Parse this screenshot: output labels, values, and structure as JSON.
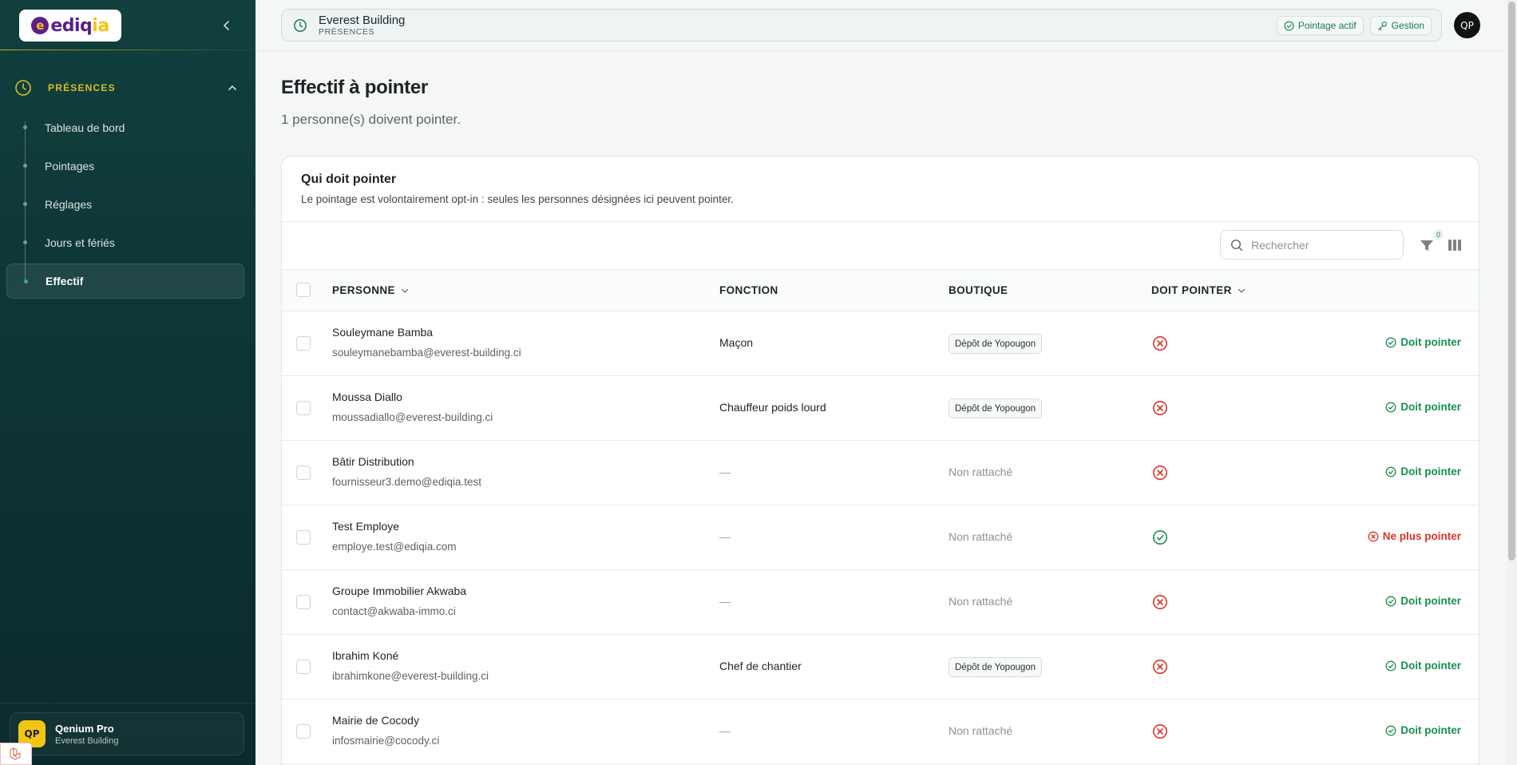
{
  "sidebar": {
    "logo": {
      "brand": "ediqia"
    },
    "section": {
      "label": "PRÉSENCES"
    },
    "items": [
      {
        "label": "Tableau de bord"
      },
      {
        "label": "Pointages"
      },
      {
        "label": "Réglages"
      },
      {
        "label": "Jours et fériés"
      },
      {
        "label": "Effectif"
      }
    ],
    "user": {
      "initials": "QP",
      "name": "Qenium Pro",
      "org": "Everest Building"
    }
  },
  "topbar": {
    "title": "Everest Building",
    "subtitle": "PRÉSENCES",
    "pills": [
      {
        "label": "Pointage actif",
        "icon": "check-circle-icon"
      },
      {
        "label": "Gestion",
        "icon": "key-icon"
      }
    ],
    "avatar": "QP"
  },
  "page": {
    "title": "Effectif à pointer",
    "subtitle": "1 personne(s) doivent pointer."
  },
  "card": {
    "title": "Qui doit pointer",
    "description": "Le pointage est volontairement opt-in : seules les personnes désignées ici peuvent pointer.",
    "search_placeholder": "Rechercher",
    "filter_count": "0",
    "columns": {
      "person": "PERSONNE",
      "function": "FONCTION",
      "shop": "BOUTIQUE",
      "must_punch": "DOIT POINTER"
    }
  },
  "rows": [
    {
      "name": "Souleymane Bamba",
      "email": "souleymanebamba@everest-building.ci",
      "function": "Maçon",
      "shop": "Dépôt de Yopougon",
      "shop_attached": true,
      "must_punch": false,
      "action": "Doit pointer"
    },
    {
      "name": "Moussa Diallo",
      "email": "moussadiallo@everest-building.ci",
      "function": "Chauffeur poids lourd",
      "shop": "Dépôt de Yopougon",
      "shop_attached": true,
      "must_punch": false,
      "action": "Doit pointer"
    },
    {
      "name": "Bâtir Distribution",
      "email": "fournisseur3.demo@ediqia.test",
      "function": "—",
      "shop": "Non rattaché",
      "shop_attached": false,
      "must_punch": false,
      "action": "Doit pointer"
    },
    {
      "name": "Test Employe",
      "email": "employe.test@ediqia.com",
      "function": "—",
      "shop": "Non rattaché",
      "shop_attached": false,
      "must_punch": true,
      "action": "Ne plus pointer"
    },
    {
      "name": "Groupe Immobilier Akwaba",
      "email": "contact@akwaba-immo.ci",
      "function": "—",
      "shop": "Non rattaché",
      "shop_attached": false,
      "must_punch": false,
      "action": "Doit pointer"
    },
    {
      "name": "Ibrahim Koné",
      "email": "ibrahimkone@everest-building.ci",
      "function": "Chef de chantier",
      "shop": "Dépôt de Yopougon",
      "shop_attached": true,
      "must_punch": false,
      "action": "Doit pointer"
    },
    {
      "name": "Mairie de Cocody",
      "email": "infosmairie@cocody.ci",
      "function": "—",
      "shop": "Non rattaché",
      "shop_attached": false,
      "must_punch": false,
      "action": "Doit pointer"
    }
  ],
  "colors": {
    "sidebar_bg": "#0d3434",
    "accent_yellow": "#d6bd2b",
    "green": "#17904f",
    "red": "#d9342b"
  }
}
